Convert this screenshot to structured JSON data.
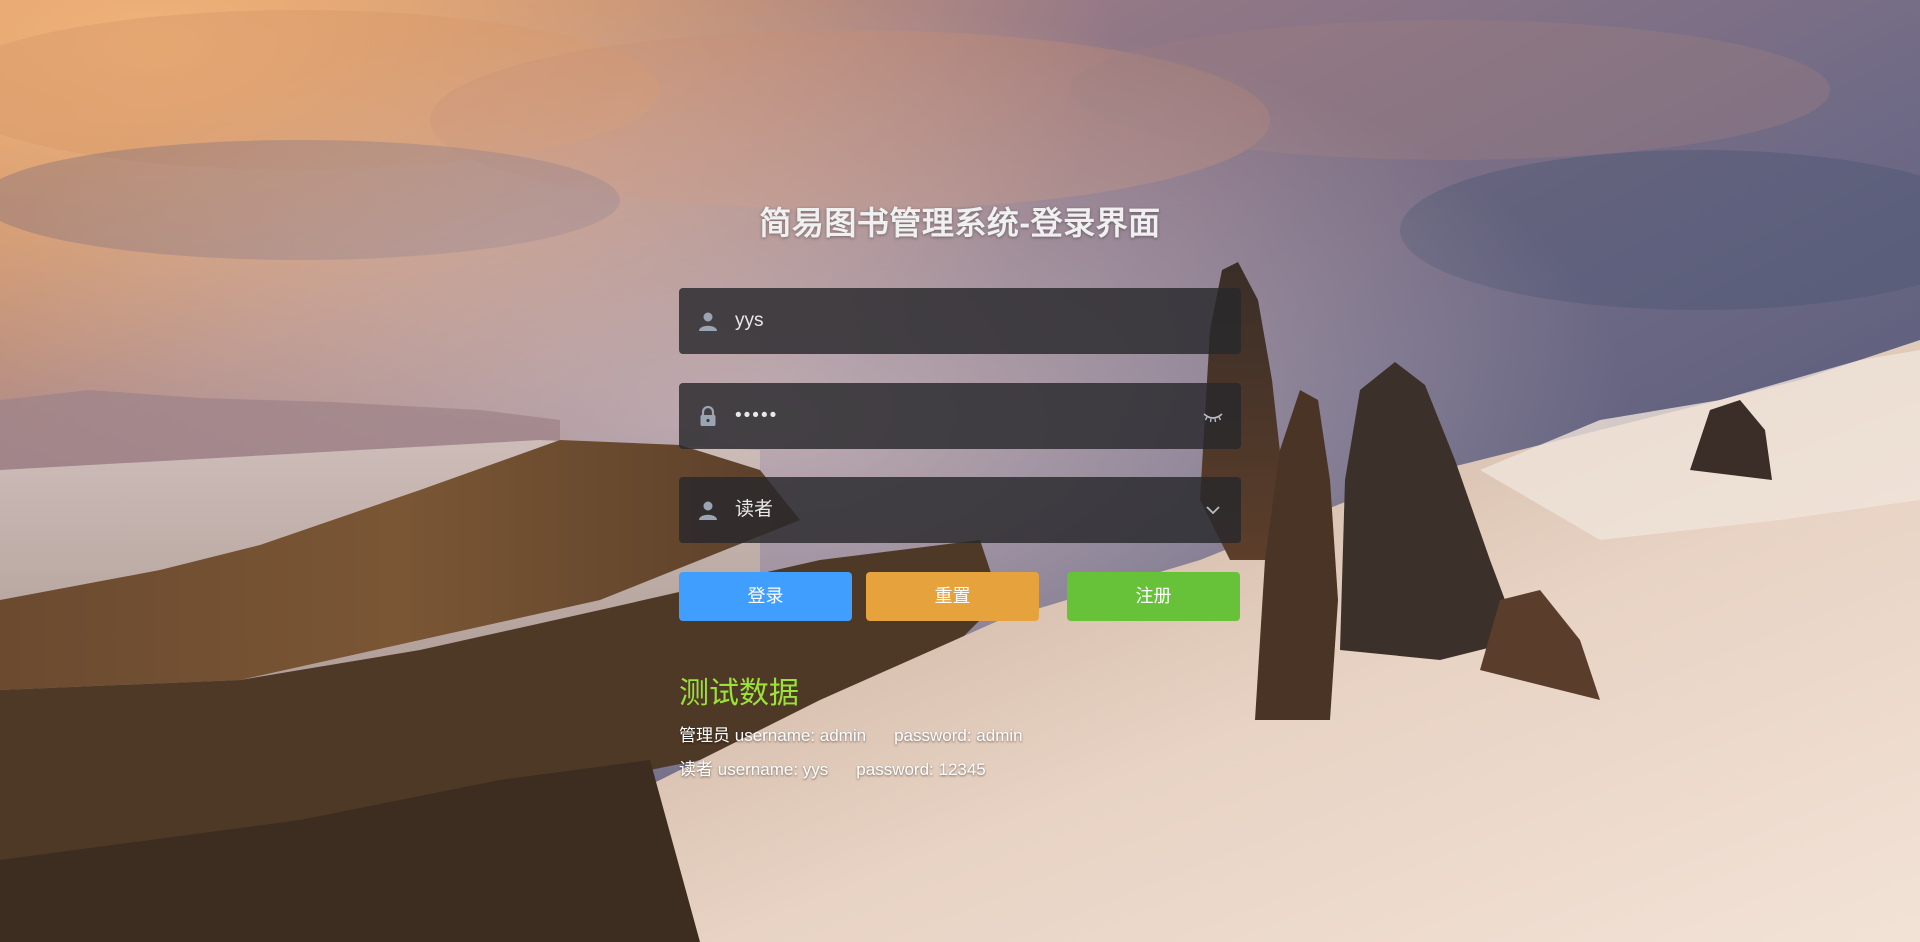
{
  "page": {
    "title": "简易图书管理系统-登录界面"
  },
  "form": {
    "username": {
      "value": "yys",
      "icon": "user-icon"
    },
    "password": {
      "value": "•••••",
      "icon": "lock-icon",
      "suffix_icon": "eye-closed-icon"
    },
    "role": {
      "value": "读者",
      "icon": "user-icon",
      "suffix_icon": "chevron-down-icon"
    }
  },
  "buttons": {
    "login": "登录",
    "reset": "重置",
    "register": "注册"
  },
  "colors": {
    "login": "#409eff",
    "reset": "#e6a23c",
    "register": "#67c23a",
    "test_title": "#9be238"
  },
  "test_data": {
    "title": "测试数据",
    "admin": {
      "role": "管理员",
      "username_text": "username: admin",
      "password_text": "password: admin"
    },
    "reader": {
      "role": "读者",
      "username_text": "username: yys",
      "password_text": "password: 12345"
    }
  }
}
